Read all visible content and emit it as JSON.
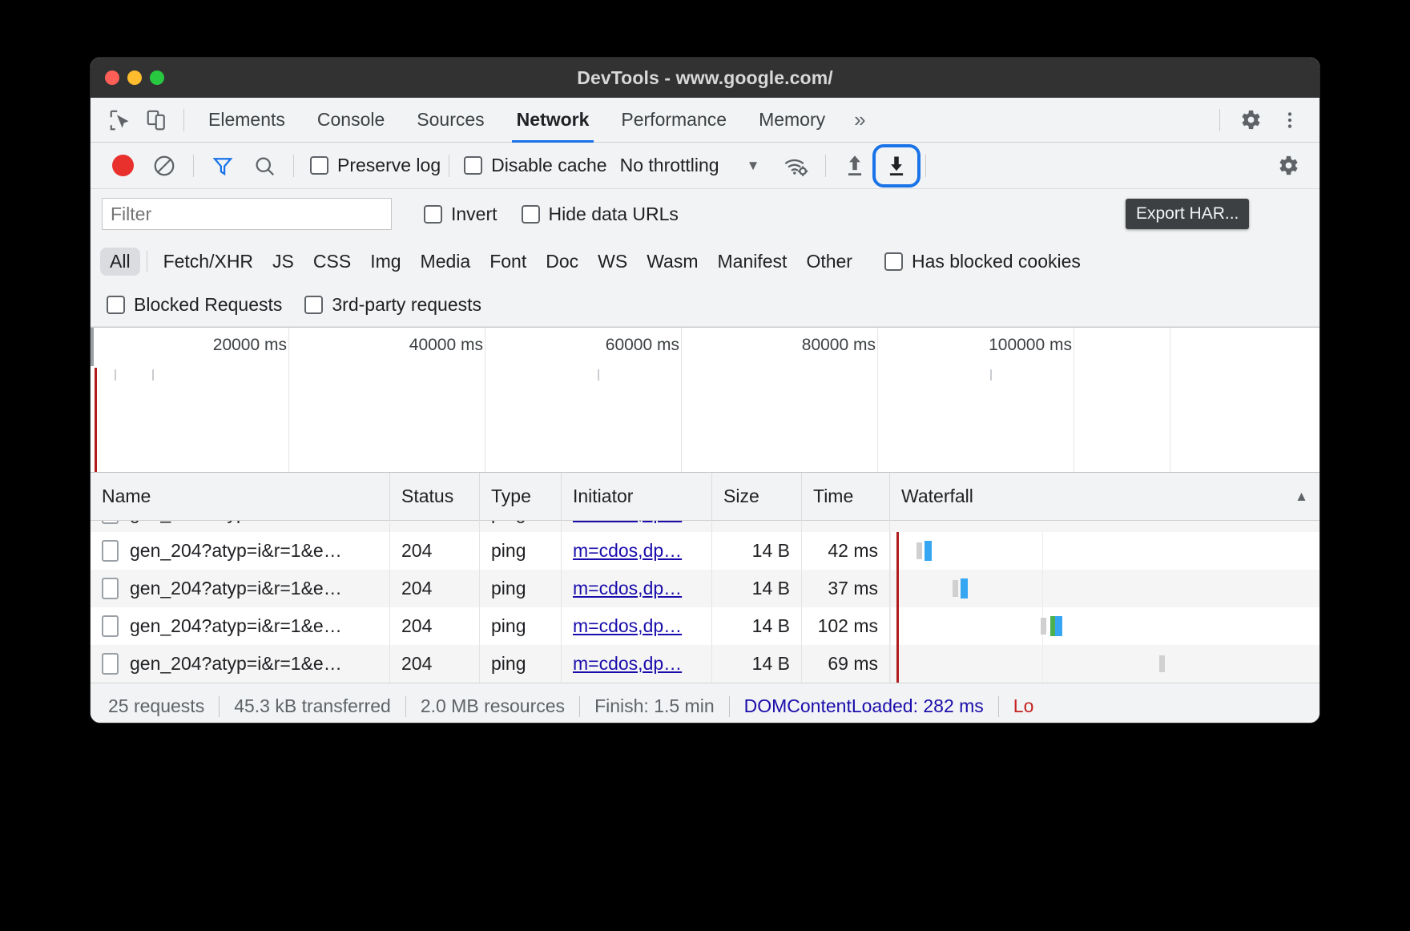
{
  "window": {
    "title": "DevTools - www.google.com/",
    "traffic_lights": [
      "close",
      "minimize",
      "maximize"
    ]
  },
  "tabstrip": {
    "inspect_icon": "inspect-cursor-icon",
    "device_icon": "device-toolbar-icon",
    "tabs": [
      {
        "label": "Elements",
        "active": false
      },
      {
        "label": "Console",
        "active": false
      },
      {
        "label": "Sources",
        "active": false
      },
      {
        "label": "Network",
        "active": true
      },
      {
        "label": "Performance",
        "active": false
      },
      {
        "label": "Memory",
        "active": false
      }
    ],
    "more_tabs": "»",
    "settings_icon": "gear-icon",
    "menu_icon": "kebab-menu-icon",
    "accent": "#1a73e8"
  },
  "network_toolbar": {
    "record_label": "record-button",
    "clear_label": "clear-button",
    "filter_icon_label": "filter-funnel-icon",
    "search_icon_label": "search-icon",
    "preserve_log": {
      "label": "Preserve log",
      "checked": false
    },
    "disable_cache": {
      "label": "Disable cache",
      "checked": false
    },
    "throttling": {
      "value": "No throttling",
      "caret": "▼"
    },
    "network_conditions_icon": "wifi-gear-icon",
    "import_icon": "import-har-upload-icon",
    "export_icon": "export-har-download-icon",
    "export_focused": true,
    "settings_icon": "gear-icon"
  },
  "tooltip": {
    "text": "Export HAR..."
  },
  "filter_row": {
    "filter_input": {
      "value": "",
      "placeholder": "Filter"
    },
    "invert": {
      "label": "Invert",
      "checked": false
    },
    "hide_data_urls": {
      "label": "Hide data URLs",
      "checked": false
    }
  },
  "type_filters": {
    "items": [
      {
        "label": "All",
        "selected": true
      },
      {
        "label": "Fetch/XHR",
        "selected": false
      },
      {
        "label": "JS",
        "selected": false
      },
      {
        "label": "CSS",
        "selected": false
      },
      {
        "label": "Img",
        "selected": false
      },
      {
        "label": "Media",
        "selected": false
      },
      {
        "label": "Font",
        "selected": false
      },
      {
        "label": "Doc",
        "selected": false
      },
      {
        "label": "WS",
        "selected": false
      },
      {
        "label": "Wasm",
        "selected": false
      },
      {
        "label": "Manifest",
        "selected": false
      },
      {
        "label": "Other",
        "selected": false
      }
    ],
    "has_blocked_cookies": {
      "label": "Has blocked cookies",
      "checked": false
    },
    "blocked_requests": {
      "label": "Blocked Requests",
      "checked": false
    },
    "third_party_requests": {
      "label": "3rd-party requests",
      "checked": false
    }
  },
  "overview": {
    "ticks": [
      "20000 ms",
      "40000 ms",
      "60000 ms",
      "80000 ms",
      "100000 ms"
    ],
    "marker_color": "#b11c1c"
  },
  "grid": {
    "columns": [
      "Name",
      "Status",
      "Type",
      "Initiator",
      "Size",
      "Time",
      "Waterfall"
    ],
    "sort_indicator": "▲",
    "rows": [
      {
        "name": "gen_204?atyp=i&r=1&e…",
        "status": "204",
        "type": "ping",
        "initiator": "m=cdos,dp…",
        "size": "14 B",
        "time": "42 ms"
      },
      {
        "name": "gen_204?atyp=i&r=1&e…",
        "status": "204",
        "type": "ping",
        "initiator": "m=cdos,dp…",
        "size": "14 B",
        "time": "37 ms"
      },
      {
        "name": "gen_204?atyp=i&r=1&e…",
        "status": "204",
        "type": "ping",
        "initiator": "m=cdos,dp…",
        "size": "14 B",
        "time": "102 ms"
      },
      {
        "name": "gen_204?atyp=i&r=1&e…",
        "status": "204",
        "type": "ping",
        "initiator": "m=cdos,dp…",
        "size": "14 B",
        "time": "69 ms"
      }
    ]
  },
  "status_bar": {
    "requests": "25 requests",
    "transferred": "45.3 kB transferred",
    "resources": "2.0 MB resources",
    "finish": "Finish: 1.5 min",
    "dom_content_loaded": "DOMContentLoaded: 282 ms",
    "load": "Lo"
  }
}
